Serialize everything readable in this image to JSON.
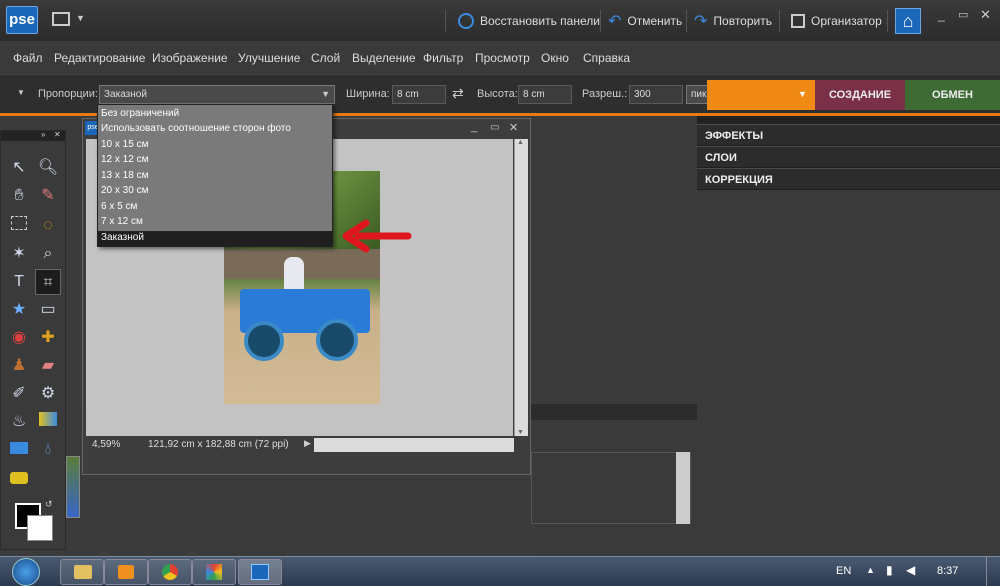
{
  "app": {
    "logo": "pse"
  },
  "titlebar": {
    "restore_panels": "Восстановить панели",
    "undo": "Отменить",
    "redo": "Повторить",
    "organizer": "Организатор"
  },
  "menu": [
    "Файл",
    "Редактирование",
    "Изображение",
    "Улучшение",
    "Слой",
    "Выделение",
    "Фильтр",
    "Просмотр",
    "Окно",
    "Справка"
  ],
  "options": {
    "proportions_label": "Пропорции:",
    "proportions_value": "Заказной",
    "width_label": "Ширина:",
    "width_value": "8 cm",
    "height_label": "Высота:",
    "height_value": "8 cm",
    "resolution_label": "Разреш.:",
    "resolution_value": "300",
    "units_value": "пикс/дюйм"
  },
  "tabs": {
    "create": "СОЗДАНИЕ",
    "share": "ОБМЕН"
  },
  "panels": [
    "ЭФФЕКТЫ",
    "СЛОИ",
    "КОРРЕКЦИЯ"
  ],
  "dropdown": {
    "items": [
      "Без ограничений",
      "Использовать соотношение сторон фото",
      "10 x 15 см",
      "12 x 12 см",
      "13 x 18 см",
      "20 x 30 см",
      "6 x 5 см",
      "7 x 12 см",
      "Заказной"
    ],
    "selected_index": 8
  },
  "document": {
    "zoom": "4,59%",
    "info": "121,92 cm x 182,88 cm (72 ppi)"
  },
  "taskbar": {
    "lang": "EN",
    "time": "8:37"
  },
  "colors": {
    "accent": "#f08a14",
    "create": "#7a3046",
    "share": "#3e6a34",
    "arrow": "#e0161e"
  }
}
